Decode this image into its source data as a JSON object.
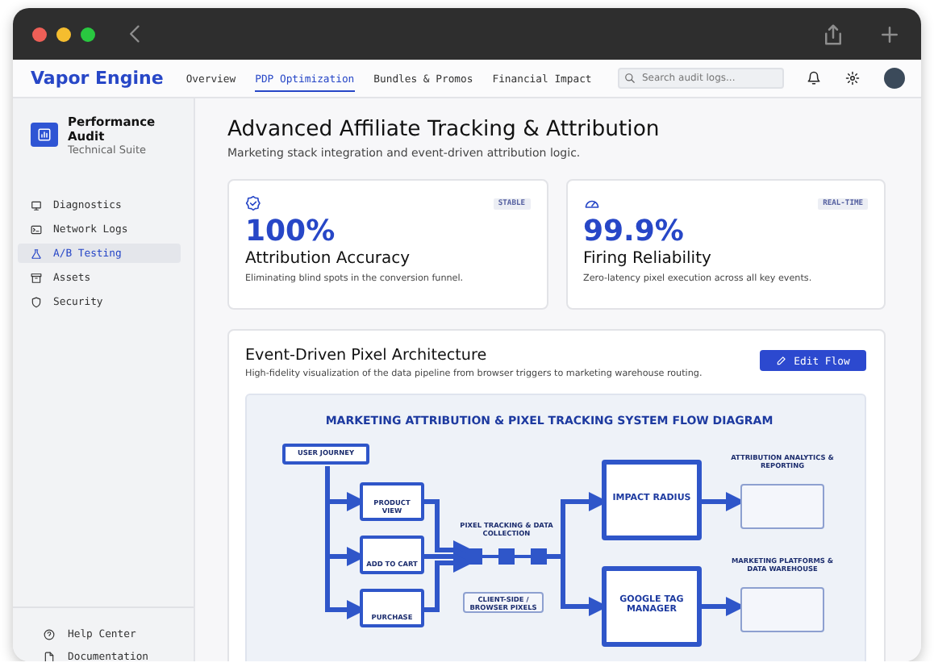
{
  "brand": "Vapor Engine",
  "nav": [
    {
      "label": "Overview",
      "selected": false
    },
    {
      "label": "PDP Optimization",
      "selected": true
    },
    {
      "label": "Bundles & Promos",
      "selected": false
    },
    {
      "label": "Financial Impact",
      "selected": false
    }
  ],
  "search": {
    "placeholder": "Search audit logs..."
  },
  "sidebar": {
    "title": "Performance Audit",
    "subtitle": "Technical Suite",
    "items": [
      {
        "label": "Diagnostics",
        "selected": false,
        "kind": "monitor"
      },
      {
        "label": "Network Logs",
        "selected": false,
        "kind": "terminal"
      },
      {
        "label": "A/B Testing",
        "selected": true,
        "kind": "flask"
      },
      {
        "label": "Assets",
        "selected": false,
        "kind": "archive"
      },
      {
        "label": "Security",
        "selected": false,
        "kind": "shield"
      }
    ],
    "footer": [
      {
        "label": "Help Center",
        "kind": "help"
      },
      {
        "label": "Documentation",
        "kind": "doc"
      }
    ]
  },
  "page": {
    "title": "Advanced Affiliate Tracking & Attribution",
    "subtitle": "Marketing stack integration and event-driven attribution logic."
  },
  "stats": [
    {
      "kind": "badge",
      "badge": "STABLE",
      "value": "100%",
      "label": "Attribution Accuracy",
      "description": "Eliminating blind spots in the conversion funnel."
    },
    {
      "kind": "gauge",
      "badge": "REAL-TIME",
      "value": "99.9%",
      "label": "Firing Reliability",
      "description": "Zero-latency pixel execution across all key events."
    }
  ],
  "architecture": {
    "title": "Event-Driven Pixel Architecture",
    "description": "High-fidelity visualization of the data pipeline from browser triggers to marketing warehouse routing.",
    "button": "Edit Flow",
    "diagram": {
      "title": "MARKETING ATTRIBUTION & PIXEL TRACKING SYSTEM FLOW DIAGRAM",
      "source": "USER JOURNEY",
      "steps": [
        "PRODUCT VIEW",
        "ADD TO CART",
        "PURCHASE"
      ],
      "collector": "PIXEL TRACKING & DATA COLLECTION",
      "client": "CLIENT-SIDE / BROWSER PIXELS",
      "hubs": [
        "IMPACT RADIUS",
        "GOOGLE TAG MANAGER"
      ],
      "outputs": [
        "ATTRIBUTION ANALYTICS & REPORTING",
        "MARKETING PLATFORMS & DATA WAREHOUSE"
      ]
    }
  }
}
